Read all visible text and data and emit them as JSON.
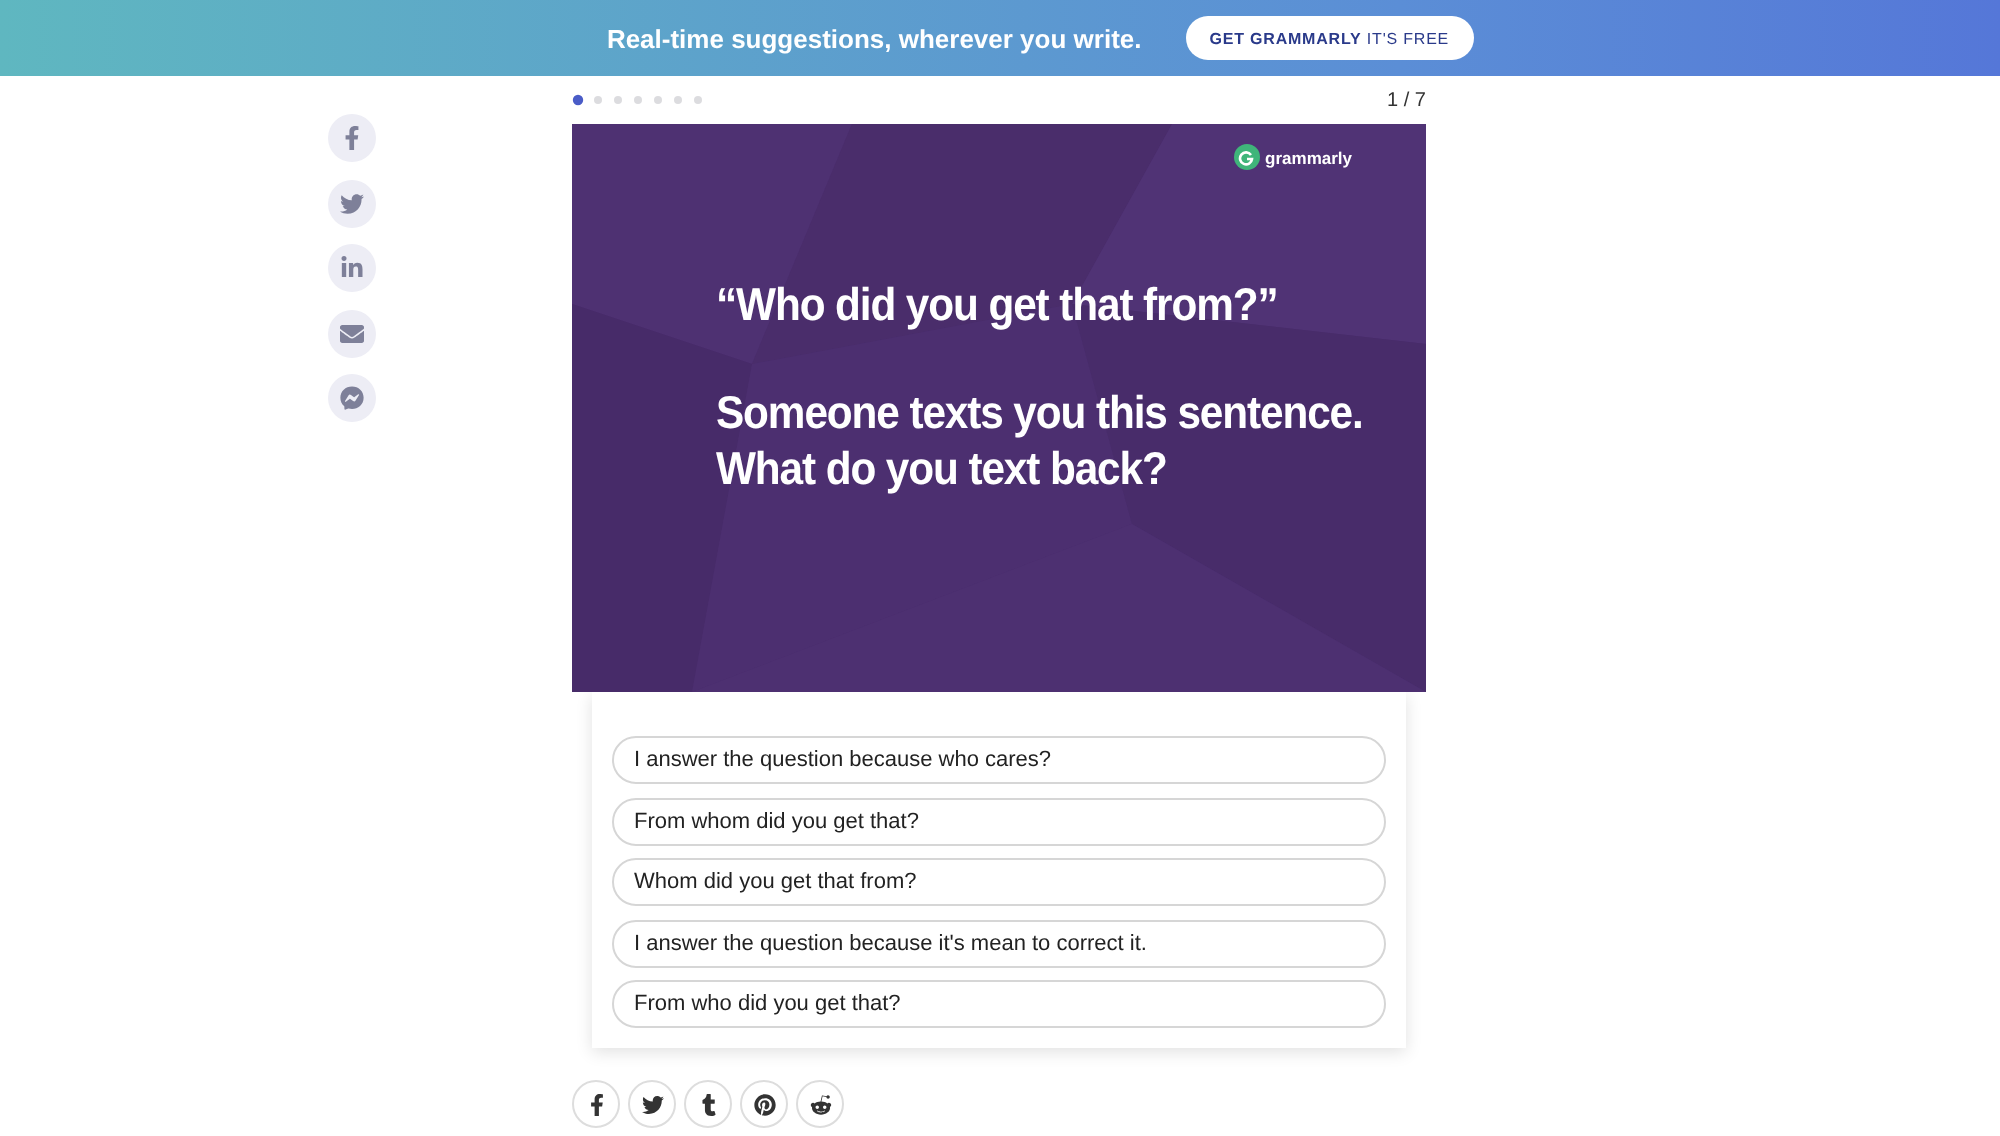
{
  "banner": {
    "text": "Real-time suggestions, wherever you write.",
    "button": "**GET GRAMMARLY** IT'S FREE"
  },
  "slides": {
    "dots": [
      {
        "selected": true
      },
      {
        "selected": false
      },
      {
        "selected": false
      },
      {
        "selected": false
      },
      {
        "selected": false
      },
      {
        "selected": false
      },
      {
        "selected": false
      }
    ],
    "counter": "1 / 7"
  },
  "card": {
    "logo": "grammarly",
    "paragraphs": [
      "“Who did you get that from?”",
      "Someone texts you this sentence.\nWhat do you text back?"
    ]
  },
  "answers": [
    {
      "text": "I answer the question because who cares?",
      "selected": false
    },
    {
      "text": "From whom did you get that?",
      "selected": false
    },
    {
      "text": "Whom did you get that from?",
      "selected": false
    },
    {
      "text": "I answer the question because it's mean to correct it.",
      "selected": false
    },
    {
      "text": "From who did you get that?",
      "selected": false
    }
  ]
}
